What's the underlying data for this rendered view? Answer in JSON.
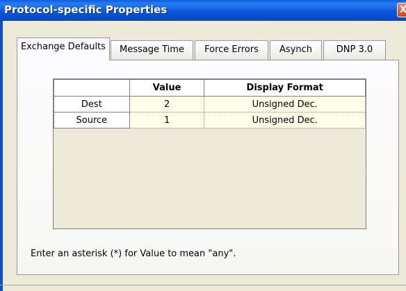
{
  "window": {
    "title": "Protocol-specific Properties",
    "close_glyph": "X"
  },
  "tabs": [
    {
      "label": "Exchange Defaults",
      "active": true
    },
    {
      "label": "Message Time",
      "active": false
    },
    {
      "label": "Force Errors",
      "active": false
    },
    {
      "label": "Asynch",
      "active": false
    },
    {
      "label": "DNP 3.0",
      "active": false
    }
  ],
  "grid": {
    "columns": [
      "",
      "Value",
      "Display Format"
    ],
    "rows": [
      {
        "name": "Dest",
        "value": "2",
        "format": "Unsigned Dec."
      },
      {
        "name": "Source",
        "value": "1",
        "format": "Unsigned Dec."
      }
    ]
  },
  "hint": "Enter an asterisk (*) for Value to mean \"any\".",
  "colors": {
    "title_bar": "#0a58d8",
    "dialog_bg": "#ece9d8",
    "cell_bg": "#fffee8"
  }
}
